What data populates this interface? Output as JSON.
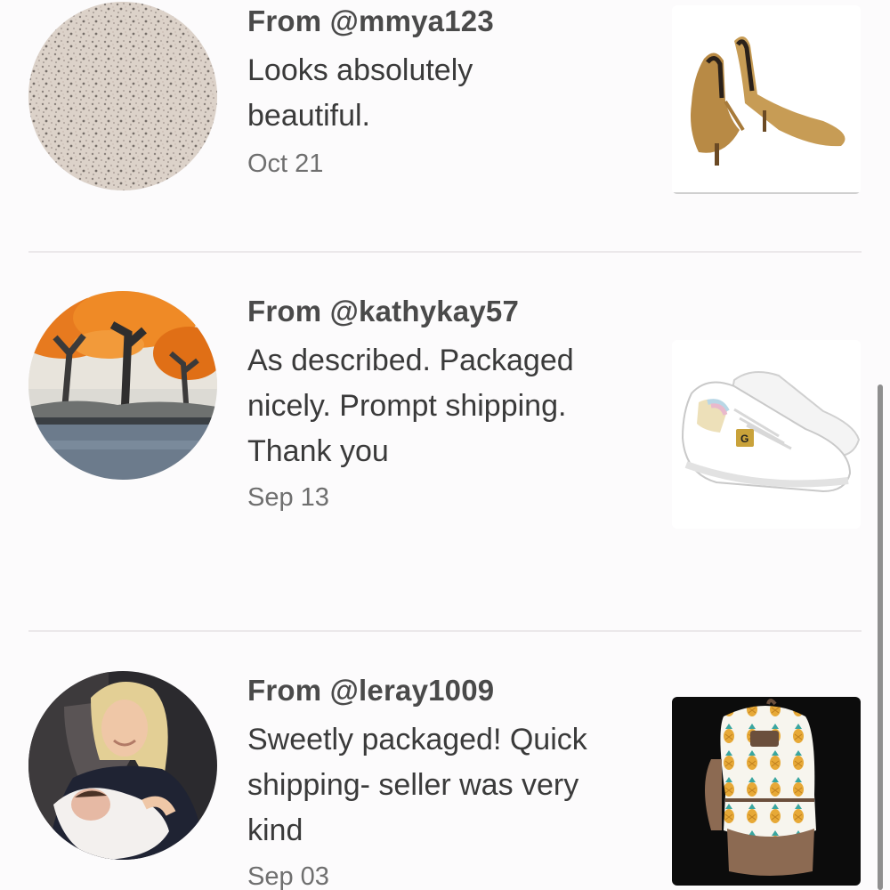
{
  "reviews": [
    {
      "from": "From @mmya123",
      "comment": "Looks absolutely beautiful.",
      "date": "Oct 21",
      "avatar": "granite-texture-avatar",
      "product": "gold-pointed-heels-thumbnail"
    },
    {
      "from": "From @kathykay57",
      "comment": "As described. Packaged nicely. Prompt shipping. Thank you",
      "date": "Sep 13",
      "avatar": "autumn-trees-painting-avatar",
      "product": "white-sneakers-thumbnail"
    },
    {
      "from": "From @leray1009",
      "comment": "Sweetly packaged! Quick shipping- seller was very kind",
      "date": "Sep 03",
      "avatar": "woman-with-baby-avatar",
      "product": "pineapple-backpack-thumbnail"
    }
  ],
  "colors": {
    "background": "#fcfbfc",
    "username": "#4a4a4a",
    "comment": "#3a3a3a",
    "date": "#6f6f6f",
    "divider": "#ebe8ea"
  }
}
